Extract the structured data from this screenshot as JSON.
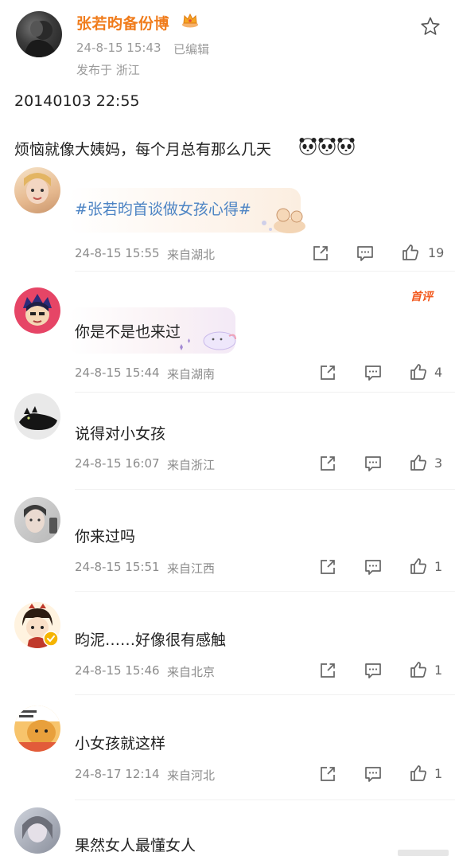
{
  "post": {
    "author": "张若昀备份博",
    "timestamp": "24-8-15 15:43",
    "edited": "已编辑",
    "location": "发布于 浙江",
    "line1": "20140103 22:55",
    "line2": "烦恼就像大姨妈，每个月总有那么几天"
  },
  "comments": [
    {
      "text": "#张若昀首谈做女孩心得#",
      "time": "24-8-15 15:55",
      "loc": "来自湖北",
      "likes": "19"
    },
    {
      "text": "你是不是也来过",
      "time": "24-8-15 15:44",
      "loc": "来自湖南",
      "likes": "4",
      "badge": "首评"
    },
    {
      "text": "说得对小女孩",
      "time": "24-8-15 16:07",
      "loc": "来自浙江",
      "likes": "3"
    },
    {
      "text": "你来过吗",
      "time": "24-8-15 15:51",
      "loc": "来自江西",
      "likes": "1"
    },
    {
      "text": "昀泥……好像很有感触",
      "time": "24-8-15 15:46",
      "loc": "来自北京",
      "likes": "1"
    },
    {
      "text": "小女孩就这样",
      "time": "24-8-17 12:14",
      "loc": "来自河北",
      "likes": "1"
    },
    {
      "text": "果然女人最懂女人"
    }
  ],
  "icons": {
    "crown": "crown-icon",
    "star": "star-outline-icon",
    "share": "share-icon",
    "comment": "comment-icon",
    "like": "thumbs-up-icon"
  },
  "colors": {
    "author": "#f07c1c",
    "topic": "#4d84c4",
    "meta": "#9a9a9a",
    "badge": "#f25a1f"
  }
}
